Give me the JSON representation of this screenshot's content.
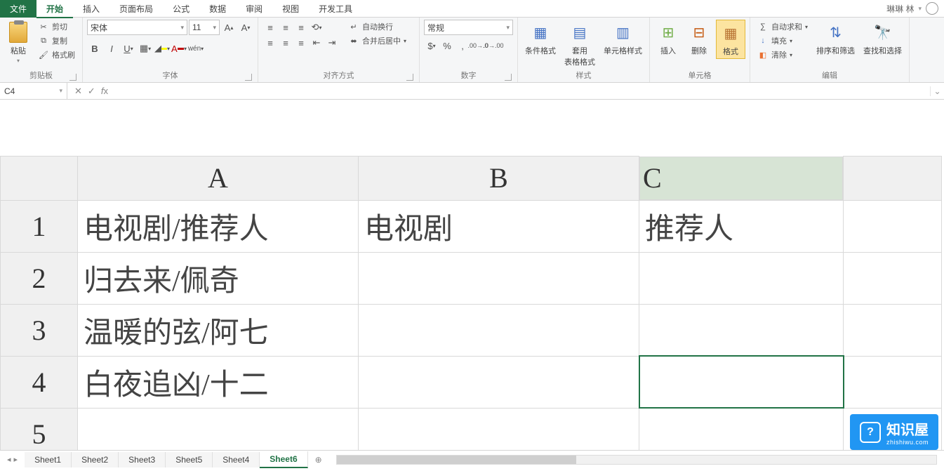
{
  "menu": {
    "file": "文件",
    "home": "开始",
    "insert": "插入",
    "layout": "页面布局",
    "formula": "公式",
    "data": "数据",
    "review": "审阅",
    "view": "视图",
    "dev": "开发工具"
  },
  "user": {
    "name": "琳琳 林"
  },
  "ribbon": {
    "clipboard": {
      "paste": "粘贴",
      "cut": "剪切",
      "copy": "复制",
      "painter": "格式刷",
      "label": "剪贴板"
    },
    "font": {
      "name": "宋体",
      "size": "11",
      "label": "字体",
      "pinyin": "wén"
    },
    "align": {
      "wrap": "自动换行",
      "merge": "合并后居中",
      "label": "对齐方式"
    },
    "number": {
      "format": "常规",
      "label": "数字"
    },
    "styles": {
      "cond": "条件格式",
      "table": "套用\n表格格式",
      "cell": "单元格样式",
      "label": "样式"
    },
    "cells": {
      "insert": "插入",
      "delete": "删除",
      "format": "格式",
      "label": "单元格"
    },
    "editing": {
      "sum": "自动求和",
      "fill": "填充",
      "clear": "清除",
      "sort": "排序和筛选",
      "find": "查找和选择",
      "label": "编辑"
    }
  },
  "namebox": {
    "cell": "C4"
  },
  "columns": [
    "A",
    "B",
    "C"
  ],
  "rows": [
    {
      "n": "1",
      "a": "电视剧/推荐人",
      "b": "电视剧",
      "c": "推荐人"
    },
    {
      "n": "2",
      "a": "归去来/佩奇",
      "b": "",
      "c": ""
    },
    {
      "n": "3",
      "a": "温暖的弦/阿七",
      "b": "",
      "c": ""
    },
    {
      "n": "4",
      "a": "白夜追凶/十二",
      "b": "",
      "c": ""
    },
    {
      "n": "5",
      "a": "",
      "b": "",
      "c": ""
    }
  ],
  "sheets": [
    "Sheet1",
    "Sheet2",
    "Sheet3",
    "Sheet5",
    "Sheet4",
    "Sheet6"
  ],
  "active_sheet": "Sheet6",
  "watermark": {
    "title": "知识屋",
    "sub": "zhishiwu.com"
  }
}
